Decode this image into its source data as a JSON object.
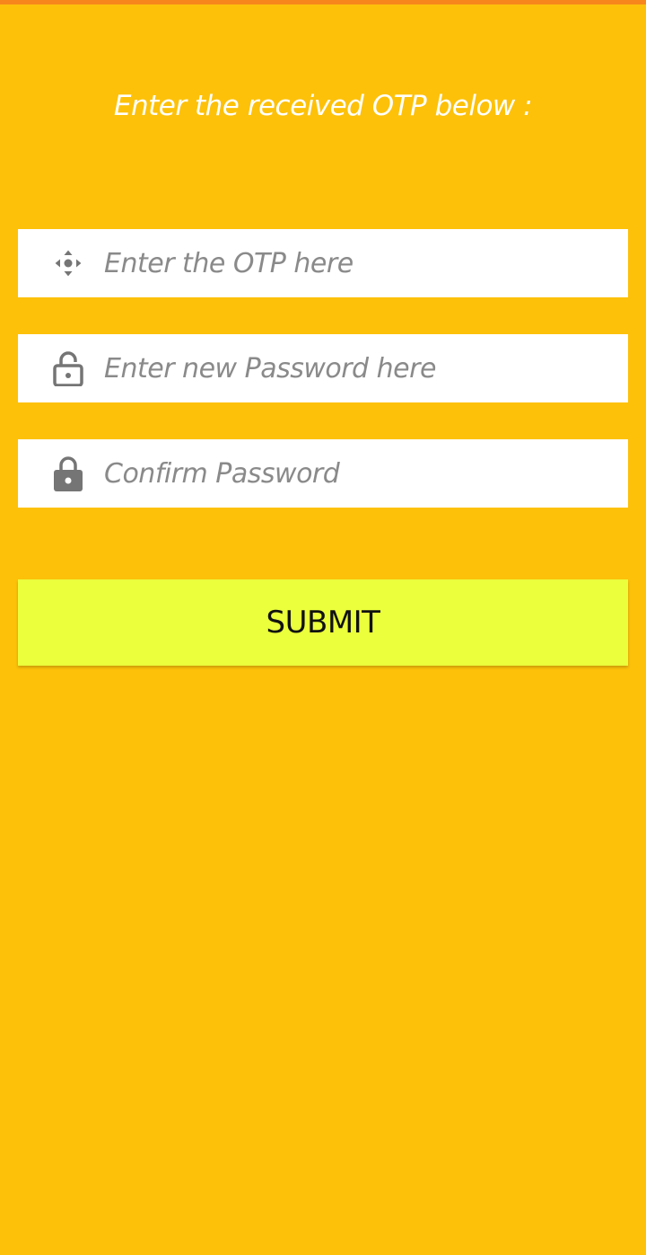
{
  "heading": "Enter the received OTP below :",
  "fields": {
    "otp": {
      "placeholder": "Enter the OTP here",
      "icon": "dpad-icon"
    },
    "new_password": {
      "placeholder": "Enter new Password here",
      "icon": "lock-open-icon"
    },
    "confirm_password": {
      "placeholder": "Confirm Password",
      "icon": "lock-icon"
    }
  },
  "submit_label": "SUBMIT",
  "colors": {
    "background": "#FDC10A",
    "top_strip": "#F7871C",
    "submit_bg": "#EBFF3C",
    "icon": "#757575"
  }
}
